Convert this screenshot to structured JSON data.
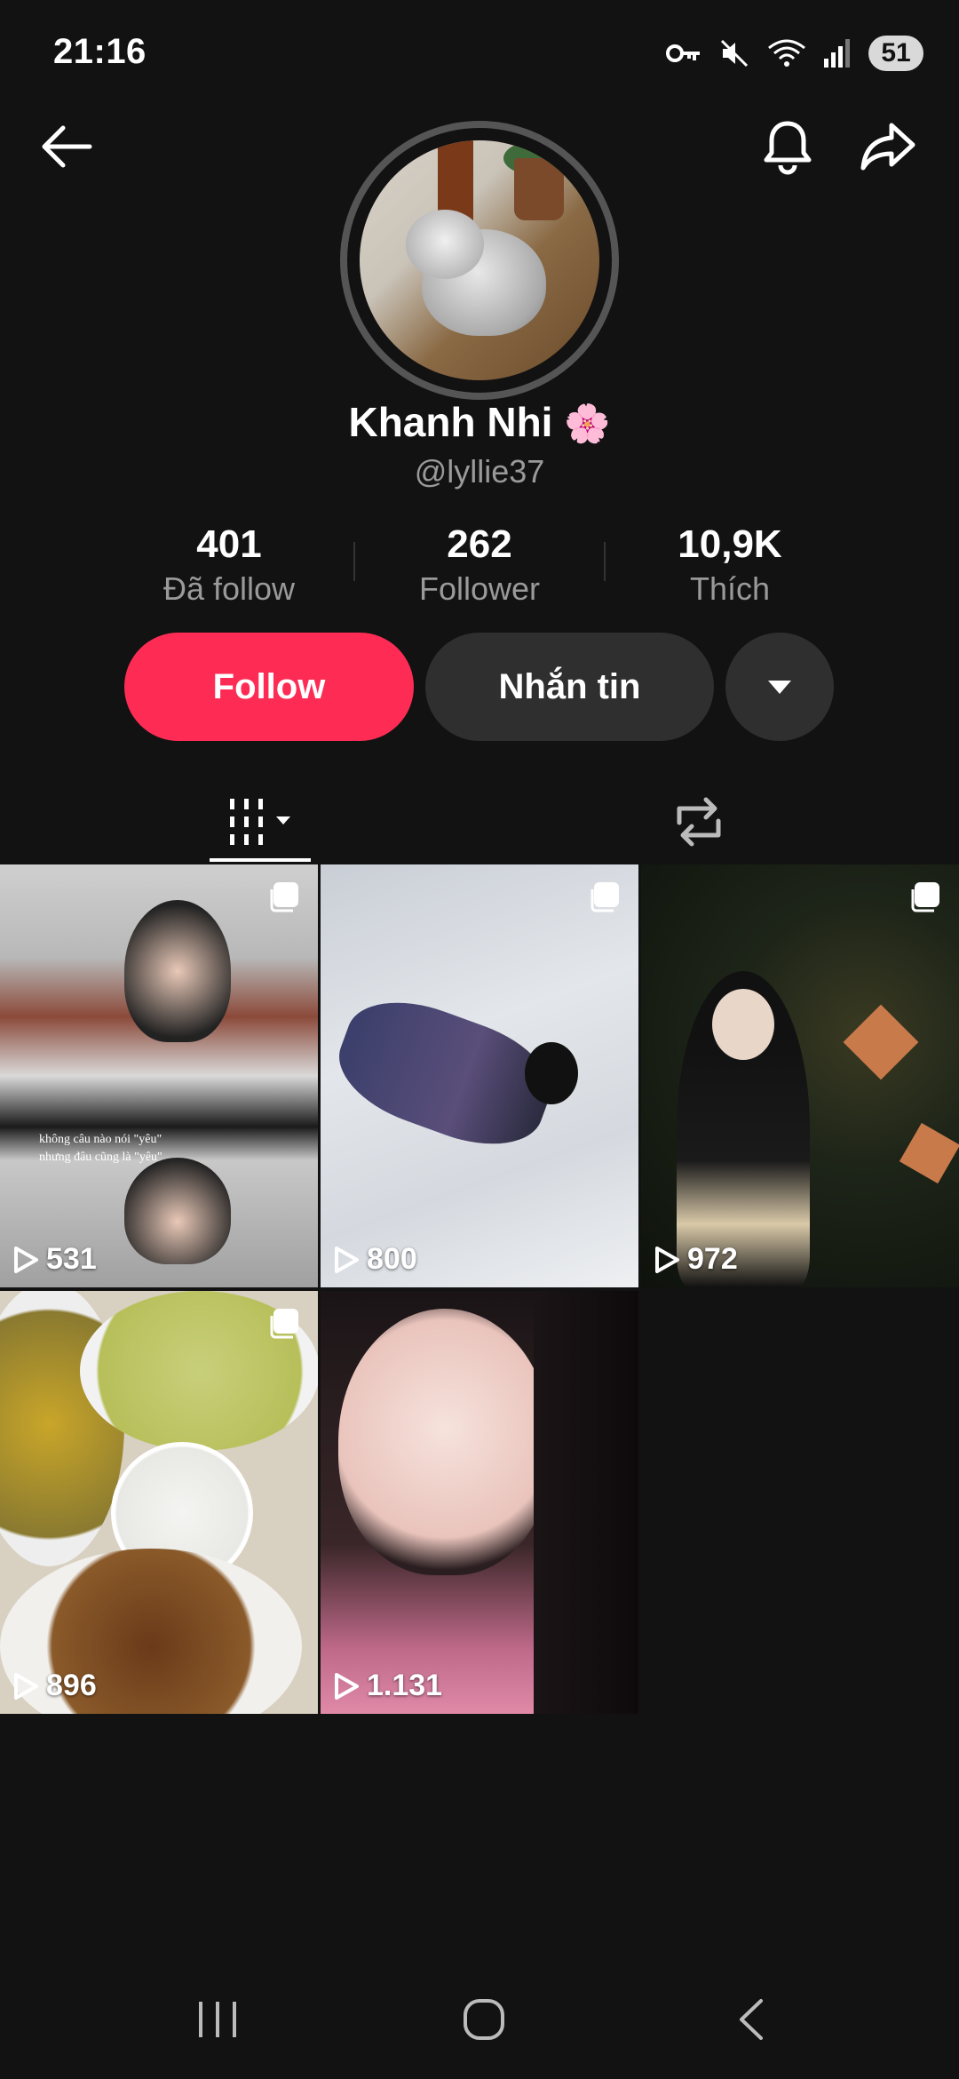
{
  "status_bar": {
    "time": "21:16",
    "battery": "51",
    "icons": [
      "key-icon",
      "mute-icon",
      "wifi-icon",
      "signal-icon"
    ]
  },
  "top_bar": {
    "back_icon": "back-arrow-icon",
    "bell_icon": "bell-icon",
    "share_icon": "share-icon"
  },
  "profile": {
    "name": "Khanh Nhi",
    "emoji": "🌸",
    "handle": "@lyllie37"
  },
  "stats": [
    {
      "value": "401",
      "label": "Đã follow"
    },
    {
      "value": "262",
      "label": "Follower"
    },
    {
      "value": "10,9K",
      "label": "Thích"
    }
  ],
  "actions": {
    "follow": "Follow",
    "message": "Nhắn tin"
  },
  "tabs": {
    "videos_icon": "grid-videos-icon",
    "reposts_icon": "repost-icon"
  },
  "videos": [
    {
      "views": "531",
      "multi": true,
      "caption_line1": "không câu nào nói \"yêu\"",
      "caption_line2": "nhưng đâu cũng là \"yêu\""
    },
    {
      "views": "800",
      "multi": true
    },
    {
      "views": "972",
      "multi": true
    },
    {
      "views": "896",
      "multi": true
    },
    {
      "views": "1.131",
      "multi": false
    }
  ],
  "colors": {
    "background": "#121212",
    "accent": "#fe2c55",
    "secondary_button": "#2f2f2f",
    "muted_text": "#9a9a9a"
  }
}
